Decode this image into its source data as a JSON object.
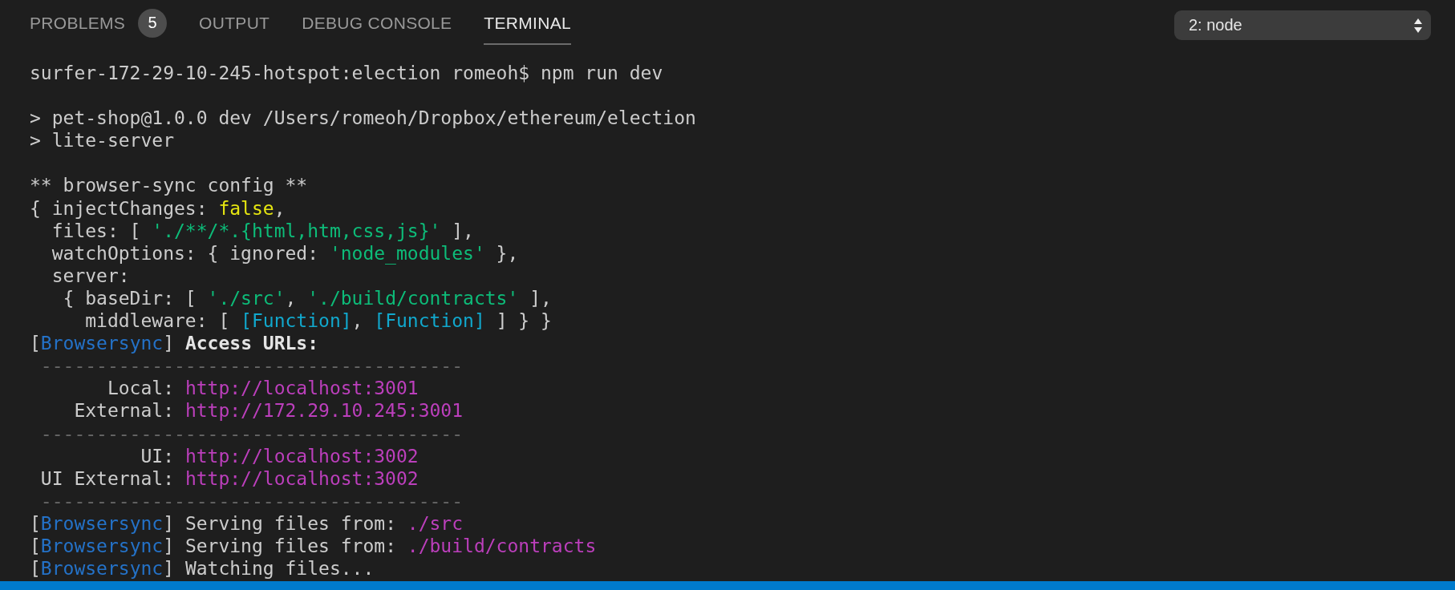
{
  "tabs": [
    {
      "label": "PROBLEMS",
      "badge": "5",
      "selected": false
    },
    {
      "label": "OUTPUT",
      "selected": false
    },
    {
      "label": "DEBUG CONSOLE",
      "selected": false
    },
    {
      "label": "TERMINAL",
      "selected": true
    }
  ],
  "terminal_select": {
    "value": "2: node"
  },
  "terminal_blocks": [
    [
      [
        {
          "kind": "plain",
          "text": "surfer-172-29-10-245-hotspot:election romeoh$ npm run dev"
        }
      ]
    ],
    [
      [
        {
          "kind": "plain",
          "text": "> pet-shop@1.0.0 dev /Users/romeoh/Dropbox/ethereum/election"
        }
      ],
      [
        {
          "kind": "plain",
          "text": "> lite-server"
        }
      ]
    ],
    [
      [
        {
          "kind": "plain",
          "text": "** browser-sync config **"
        }
      ],
      [
        {
          "kind": "plain",
          "text": "{ injectChanges: "
        },
        {
          "kind": "keyword",
          "text": "false"
        },
        {
          "kind": "plain",
          "text": ","
        }
      ],
      [
        {
          "kind": "plain",
          "text": "  files: [ "
        },
        {
          "kind": "string",
          "text": "'./**/*.{html,htm,css,js}'"
        },
        {
          "kind": "plain",
          "text": " ],"
        }
      ],
      [
        {
          "kind": "plain",
          "text": "  watchOptions: { ignored: "
        },
        {
          "kind": "string",
          "text": "'node_modules'"
        },
        {
          "kind": "plain",
          "text": " },"
        }
      ],
      [
        {
          "kind": "plain",
          "text": "  server:"
        }
      ],
      [
        {
          "kind": "plain",
          "text": "   { baseDir: [ "
        },
        {
          "kind": "string",
          "text": "'./src'"
        },
        {
          "kind": "plain",
          "text": ", "
        },
        {
          "kind": "string",
          "text": "'./build/contracts'"
        },
        {
          "kind": "plain",
          "text": " ],"
        }
      ],
      [
        {
          "kind": "plain",
          "text": "     middleware: [ "
        },
        {
          "kind": "special",
          "text": "[Function]"
        },
        {
          "kind": "plain",
          "text": ", "
        },
        {
          "kind": "special",
          "text": "[Function]"
        },
        {
          "kind": "plain",
          "text": " ] } }"
        }
      ],
      [
        {
          "kind": "plain",
          "text": "["
        },
        {
          "kind": "tag",
          "text": "Browsersync"
        },
        {
          "kind": "plain",
          "text": "] "
        },
        {
          "kind": "bold",
          "text": "Access URLs:"
        }
      ],
      [
        {
          "kind": "dim",
          "text": " --------------------------------------"
        }
      ],
      [
        {
          "kind": "plain",
          "text": "       Local: "
        },
        {
          "kind": "url",
          "text": "http://localhost:3001"
        }
      ],
      [
        {
          "kind": "plain",
          "text": "    External: "
        },
        {
          "kind": "url",
          "text": "http://172.29.10.245:3001"
        }
      ],
      [
        {
          "kind": "dim",
          "text": " --------------------------------------"
        }
      ],
      [
        {
          "kind": "plain",
          "text": "          UI: "
        },
        {
          "kind": "url",
          "text": "http://localhost:3002"
        }
      ],
      [
        {
          "kind": "plain",
          "text": " UI External: "
        },
        {
          "kind": "url",
          "text": "http://localhost:3002"
        }
      ],
      [
        {
          "kind": "dim",
          "text": " --------------------------------------"
        }
      ],
      [
        {
          "kind": "plain",
          "text": "["
        },
        {
          "kind": "tag",
          "text": "Browsersync"
        },
        {
          "kind": "plain",
          "text": "] Serving files from: "
        },
        {
          "kind": "url",
          "text": "./src"
        }
      ],
      [
        {
          "kind": "plain",
          "text": "["
        },
        {
          "kind": "tag",
          "text": "Browsersync"
        },
        {
          "kind": "plain",
          "text": "] Serving files from: "
        },
        {
          "kind": "url",
          "text": "./build/contracts"
        }
      ],
      [
        {
          "kind": "plain",
          "text": "["
        },
        {
          "kind": "tag",
          "text": "Browsersync"
        },
        {
          "kind": "plain",
          "text": "] Watching files..."
        }
      ]
    ]
  ]
}
